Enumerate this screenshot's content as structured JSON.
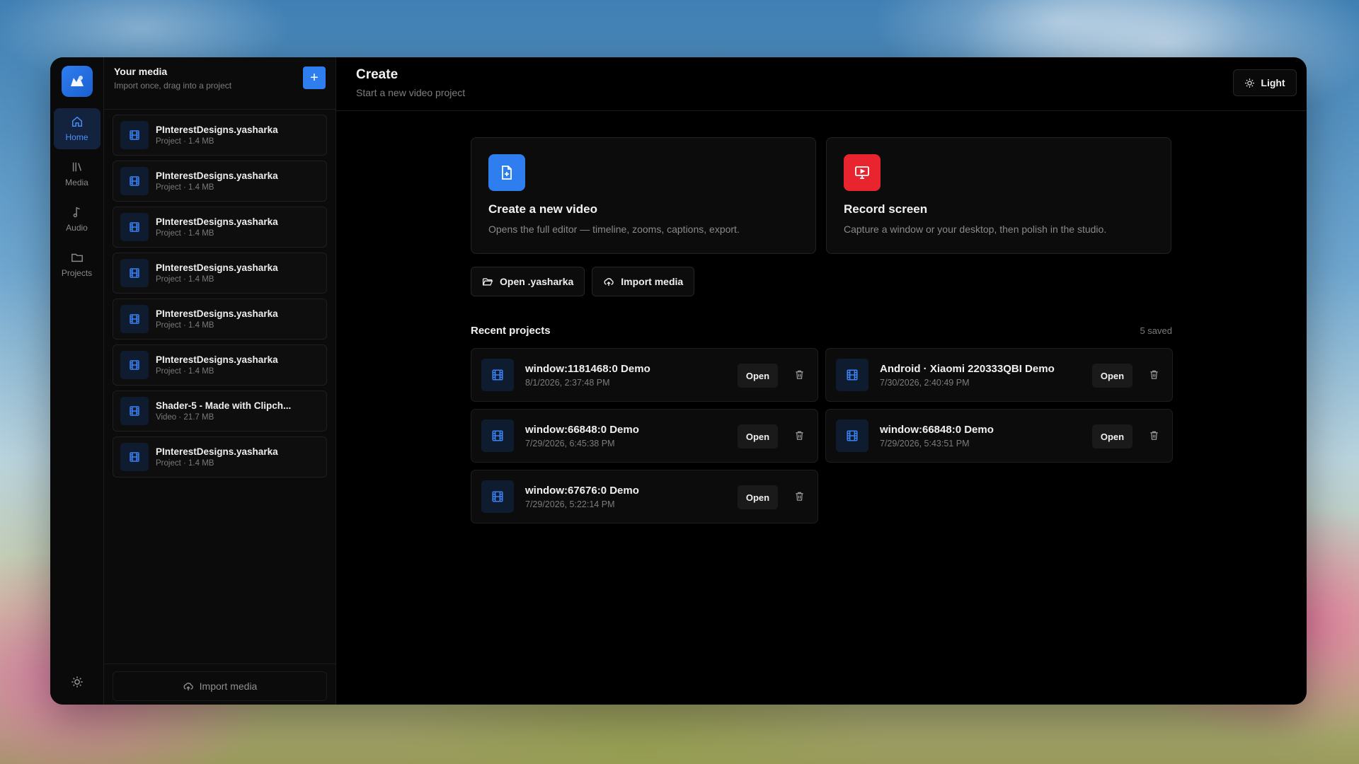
{
  "rail": {
    "items": [
      {
        "label": "Home",
        "icon": "home-icon",
        "active": true
      },
      {
        "label": "Media",
        "icon": "library-icon",
        "active": false
      },
      {
        "label": "Audio",
        "icon": "music-note-icon",
        "active": false
      },
      {
        "label": "Projects",
        "icon": "folder-icon",
        "active": false
      }
    ]
  },
  "media": {
    "title": "Your media",
    "subtitle": "Import once, drag into a project",
    "add_label": "+",
    "items": [
      {
        "name": "PInterestDesigns.yasharka",
        "meta": "Project · 1.4 MB"
      },
      {
        "name": "PInterestDesigns.yasharka",
        "meta": "Project · 1.4 MB"
      },
      {
        "name": "PInterestDesigns.yasharka",
        "meta": "Project · 1.4 MB"
      },
      {
        "name": "PInterestDesigns.yasharka",
        "meta": "Project · 1.4 MB"
      },
      {
        "name": "PInterestDesigns.yasharka",
        "meta": "Project · 1.4 MB"
      },
      {
        "name": "PInterestDesigns.yasharka",
        "meta": "Project · 1.4 MB"
      },
      {
        "name": "Shader-5 - Made with Clipch...",
        "meta": "Video · 21.7 MB"
      },
      {
        "name": "PInterestDesigns.yasharka",
        "meta": "Project · 1.4 MB"
      }
    ],
    "import_label": "Import media"
  },
  "header": {
    "title": "Create",
    "subtitle": "Start a new video project",
    "theme_label": "Light"
  },
  "cards": {
    "new_video": {
      "title": "Create a new video",
      "desc": "Opens the full editor — timeline, zooms, captions, export."
    },
    "record": {
      "title": "Record screen",
      "desc": "Capture a window or your desktop, then polish in the studio."
    }
  },
  "actions": {
    "open_label": "Open .yasharka",
    "import_label": "Import media"
  },
  "recent": {
    "title": "Recent projects",
    "count": "5 saved",
    "open_label": "Open",
    "projects": [
      {
        "name": "window:1181468:0 Demo",
        "date": "8/1/2026, 2:37:48 PM"
      },
      {
        "name": "Android · Xiaomi 220333QBI Demo",
        "date": "7/30/2026, 2:40:49 PM"
      },
      {
        "name": "window:66848:0 Demo",
        "date": "7/29/2026, 6:45:38 PM"
      },
      {
        "name": "window:66848:0 Demo",
        "date": "7/29/2026, 5:43:51 PM"
      },
      {
        "name": "window:67676:0 Demo",
        "date": "7/29/2026, 5:22:14 PM"
      }
    ]
  },
  "colors": {
    "accent": "#2f7ef0",
    "record": "#e8242f",
    "window_bg": "#000000"
  }
}
